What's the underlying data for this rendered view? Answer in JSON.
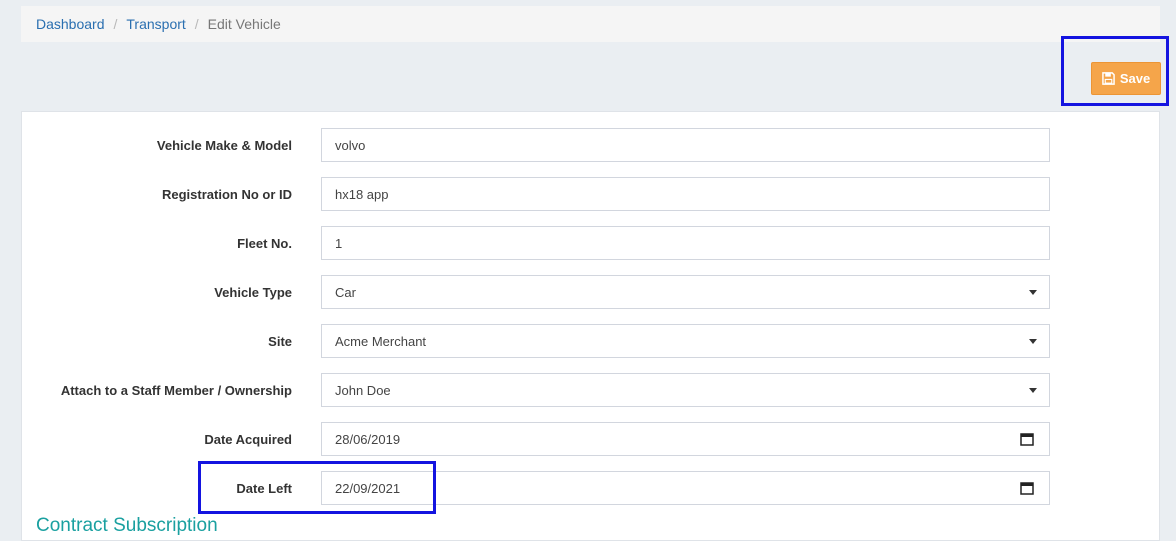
{
  "breadcrumb": {
    "items": [
      {
        "label": "Dashboard"
      },
      {
        "label": "Transport"
      },
      {
        "label": "Edit Vehicle"
      }
    ],
    "separator": "/"
  },
  "toolbar": {
    "save_label": "Save",
    "save_icon": "floppy-disk-icon",
    "accent_color": "#f5a54a"
  },
  "form": {
    "fields": [
      {
        "label": "Vehicle Make & Model",
        "value": "volvo",
        "kind": "text"
      },
      {
        "label": "Registration No or ID",
        "value": "hx18 app",
        "kind": "text"
      },
      {
        "label": "Fleet No.",
        "value": "1",
        "kind": "text"
      },
      {
        "label": "Vehicle Type",
        "value": "Car",
        "kind": "select"
      },
      {
        "label": "Site",
        "value": "Acme Merchant",
        "kind": "select"
      },
      {
        "label": "Attach to a Staff Member / Ownership",
        "value": "John Doe",
        "kind": "select"
      },
      {
        "label": "Date Acquired",
        "value": "28/06/2019",
        "kind": "date"
      },
      {
        "label": "Date Left",
        "value": "22/09/2021",
        "kind": "date"
      }
    ]
  },
  "section": {
    "title": "Contract Subscription"
  },
  "highlight_color": "#1414e0"
}
